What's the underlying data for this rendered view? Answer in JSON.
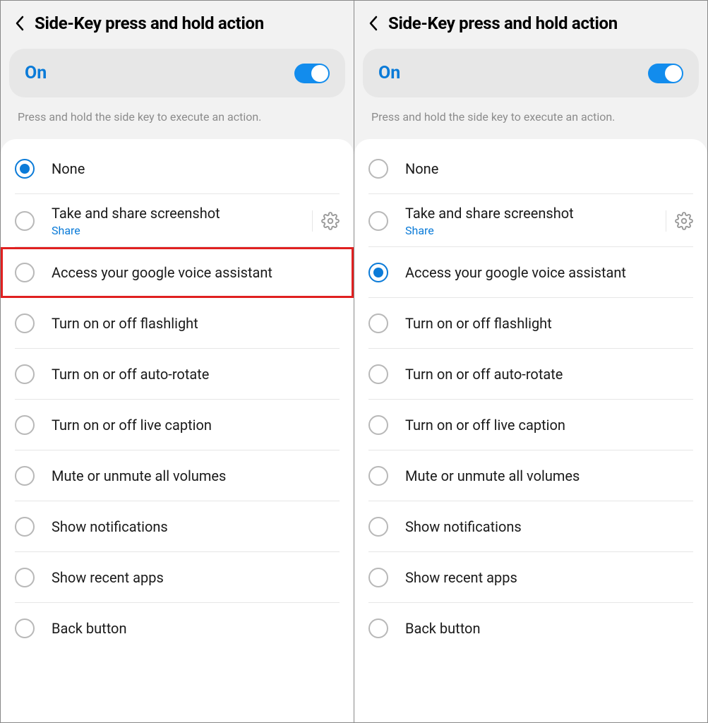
{
  "panes": [
    {
      "title": "Side-Key press and hold action",
      "toggle": {
        "label": "On",
        "state": true
      },
      "hint": "Press and hold the side key to execute an action.",
      "highlightedIndex": 2,
      "items": [
        {
          "label": "None",
          "selected": true
        },
        {
          "label": "Take and share screenshot",
          "sub": "Share",
          "gear": true
        },
        {
          "label": "Access your google voice assistant"
        },
        {
          "label": "Turn on or off flashlight"
        },
        {
          "label": "Turn on or off auto-rotate"
        },
        {
          "label": "Turn on or off live caption"
        },
        {
          "label": "Mute or unmute all volumes"
        },
        {
          "label": "Show notifications"
        },
        {
          "label": "Show recent apps"
        },
        {
          "label": "Back button"
        }
      ]
    },
    {
      "title": "Side-Key press and hold action",
      "toggle": {
        "label": "On",
        "state": true
      },
      "hint": "Press and hold the side key to execute an action.",
      "highlightedIndex": -1,
      "items": [
        {
          "label": "None"
        },
        {
          "label": "Take and share screenshot",
          "sub": "Share",
          "gear": true
        },
        {
          "label": "Access your google voice assistant",
          "selected": true
        },
        {
          "label": "Turn on or off flashlight"
        },
        {
          "label": "Turn on or off auto-rotate"
        },
        {
          "label": "Turn on or off live caption"
        },
        {
          "label": "Mute or unmute all volumes"
        },
        {
          "label": "Show notifications"
        },
        {
          "label": "Show recent apps"
        },
        {
          "label": "Back button"
        }
      ]
    }
  ]
}
